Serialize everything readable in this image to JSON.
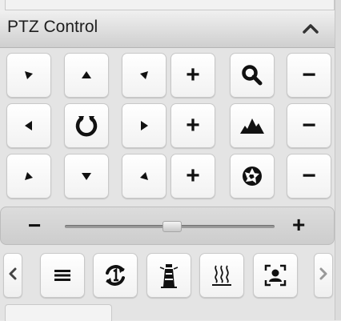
{
  "header": {
    "title": "PTZ Control",
    "collapse_icon": "chevron-up-icon"
  },
  "ptz": {
    "direction_icons": [
      "arrow-up-left-icon",
      "arrow-up-icon",
      "arrow-up-right-icon",
      "arrow-left-icon",
      "auto-rotate-icon",
      "arrow-right-icon",
      "arrow-down-left-icon",
      "arrow-down-icon",
      "arrow-down-right-icon"
    ],
    "plus_label": "+",
    "minus_label": "−",
    "lens_rows": [
      {
        "icon": "zoom-icon"
      },
      {
        "icon": "focus-icon"
      },
      {
        "icon": "iris-icon"
      }
    ]
  },
  "zoom_slider": {
    "minus_label": "−",
    "plus_label": "+",
    "level": 0.5
  },
  "toolbar": {
    "prev_icon": "chevron-left-icon",
    "next_icon": "chevron-right-icon",
    "items": [
      "menu-icon",
      "one-touch-patrol-icon",
      "lighthouse-icon",
      "heater-icon",
      "person-frame-icon"
    ]
  },
  "colors": {
    "header_top": "#f0f0f0",
    "header_bottom": "#cfcfcf",
    "panel": "#e4e4e4",
    "icon": "#111111"
  }
}
